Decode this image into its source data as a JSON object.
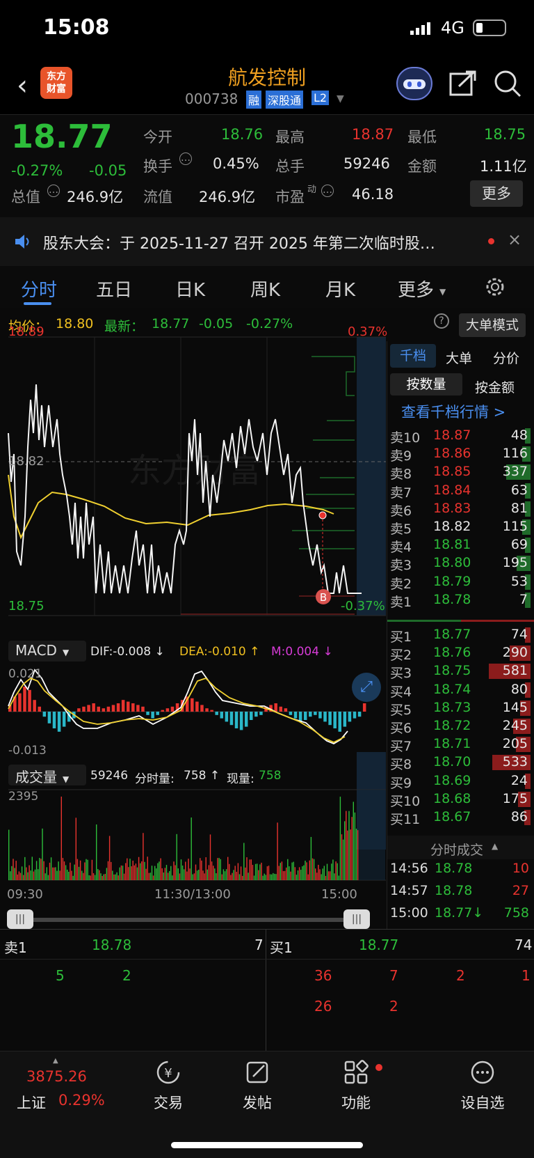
{
  "status_bar": {
    "time": "15:08",
    "network": "4G"
  },
  "header": {
    "title": "航发控制",
    "code": "000738",
    "badges": [
      "融",
      "深股通",
      "L2"
    ],
    "logo": "东方\n财富"
  },
  "quote": {
    "price": "18.77",
    "change_pct": "-0.27%",
    "change": "-0.05",
    "fields": [
      {
        "label": "今开",
        "value": "18.76"
      },
      {
        "label": "最高",
        "value": "18.87"
      },
      {
        "label": "最低",
        "value": "18.75"
      },
      {
        "label": "换手",
        "value": "0.45%"
      },
      {
        "label": "总手",
        "value": "59246"
      },
      {
        "label": "金额",
        "value": "1.11亿"
      },
      {
        "label": "总值",
        "value": "246.9亿"
      },
      {
        "label": "流值",
        "value": "246.9亿"
      },
      {
        "label": "市盈",
        "sup": "动",
        "value": "46.18"
      }
    ],
    "more_label": "更多"
  },
  "notice": {
    "text": "股东大会：于 2025-11-27 召开 2025 年第二次临时股…"
  },
  "tabs": [
    "分时",
    "五日",
    "日K",
    "周K",
    "月K",
    "更多"
  ],
  "chart": {
    "avg_label": "均价：",
    "avg_value": "18.80",
    "latest_label": "最新：",
    "latest_value": "18.77",
    "latest_change": "-0.05",
    "latest_pct": "-0.27%",
    "mode_button": "大单模式",
    "y_top": "18.89",
    "y_mid": "18.82",
    "y_bottom": "18.75",
    "pct_top": "0.37%",
    "pct_bottom": "-0.37%",
    "trade_marker": "B",
    "watermark": "东方财富",
    "macd": {
      "name": "MACD",
      "dif": "DIF:-0.008 ↓",
      "dea": "DEA:-0.010 ↑",
      "m": "M:0.004 ↓",
      "top": "0.021",
      "bottom": "-0.013"
    },
    "volume": {
      "name": "成交量",
      "total": "59246",
      "fen_label": "分时量:",
      "fen_value": "758 ↑",
      "now_label": "现量:",
      "now_value": "758",
      "max": "2395"
    },
    "time_labels": [
      "09:30",
      "11:30/13:00",
      "15:00"
    ]
  },
  "order_book": {
    "tabs": [
      "千档",
      "大单",
      "分价"
    ],
    "subtabs": [
      "按数量",
      "按金额"
    ],
    "link": "查看千档行情 >",
    "asks": [
      {
        "label": "卖10",
        "price": "18.87",
        "vol": "48"
      },
      {
        "label": "卖9",
        "price": "18.86",
        "vol": "116"
      },
      {
        "label": "卖8",
        "price": "18.85",
        "vol": "337"
      },
      {
        "label": "卖7",
        "price": "18.84",
        "vol": "63"
      },
      {
        "label": "卖6",
        "price": "18.83",
        "vol": "81"
      },
      {
        "label": "卖5",
        "price": "18.82",
        "vol": "115"
      },
      {
        "label": "卖4",
        "price": "18.81",
        "vol": "69"
      },
      {
        "label": "卖3",
        "price": "18.80",
        "vol": "195"
      },
      {
        "label": "卖2",
        "price": "18.79",
        "vol": "53"
      },
      {
        "label": "卖1",
        "price": "18.78",
        "vol": "7"
      }
    ],
    "bids": [
      {
        "label": "买1",
        "price": "18.77",
        "vol": "74"
      },
      {
        "label": "买2",
        "price": "18.76",
        "vol": "290"
      },
      {
        "label": "买3",
        "price": "18.75",
        "vol": "581"
      },
      {
        "label": "买4",
        "price": "18.74",
        "vol": "80"
      },
      {
        "label": "买5",
        "price": "18.73",
        "vol": "145"
      },
      {
        "label": "买6",
        "price": "18.72",
        "vol": "245"
      },
      {
        "label": "买7",
        "price": "18.71",
        "vol": "205"
      },
      {
        "label": "买8",
        "price": "18.70",
        "vol": "533"
      },
      {
        "label": "买9",
        "price": "18.69",
        "vol": "24"
      },
      {
        "label": "买10",
        "price": "18.68",
        "vol": "175"
      },
      {
        "label": "买11",
        "price": "18.67",
        "vol": "86"
      }
    ],
    "trades_title": "分时成交",
    "trades": [
      {
        "time": "14:56",
        "price": "18.78",
        "vol": "10"
      },
      {
        "time": "14:57",
        "price": "18.78",
        "vol": "27"
      },
      {
        "time": "15:00",
        "price": "18.77↓",
        "vol": "758"
      }
    ]
  },
  "bottom_queue": {
    "sell_label": "卖1",
    "sell_price": "18.78",
    "sell_vol": "7",
    "buy_label": "买1",
    "buy_price": "18.77",
    "buy_vol": "74",
    "sell_queue": [
      "5",
      "2"
    ],
    "buy_queue_row1": [
      "36",
      "7",
      "2",
      "1"
    ],
    "buy_queue_row2": [
      "26",
      "2"
    ]
  },
  "nav": {
    "index_value": "3875.26",
    "index_name": "上证",
    "index_pct": "0.29%",
    "items": [
      "交易",
      "发帖",
      "功能",
      "设自选"
    ]
  }
}
